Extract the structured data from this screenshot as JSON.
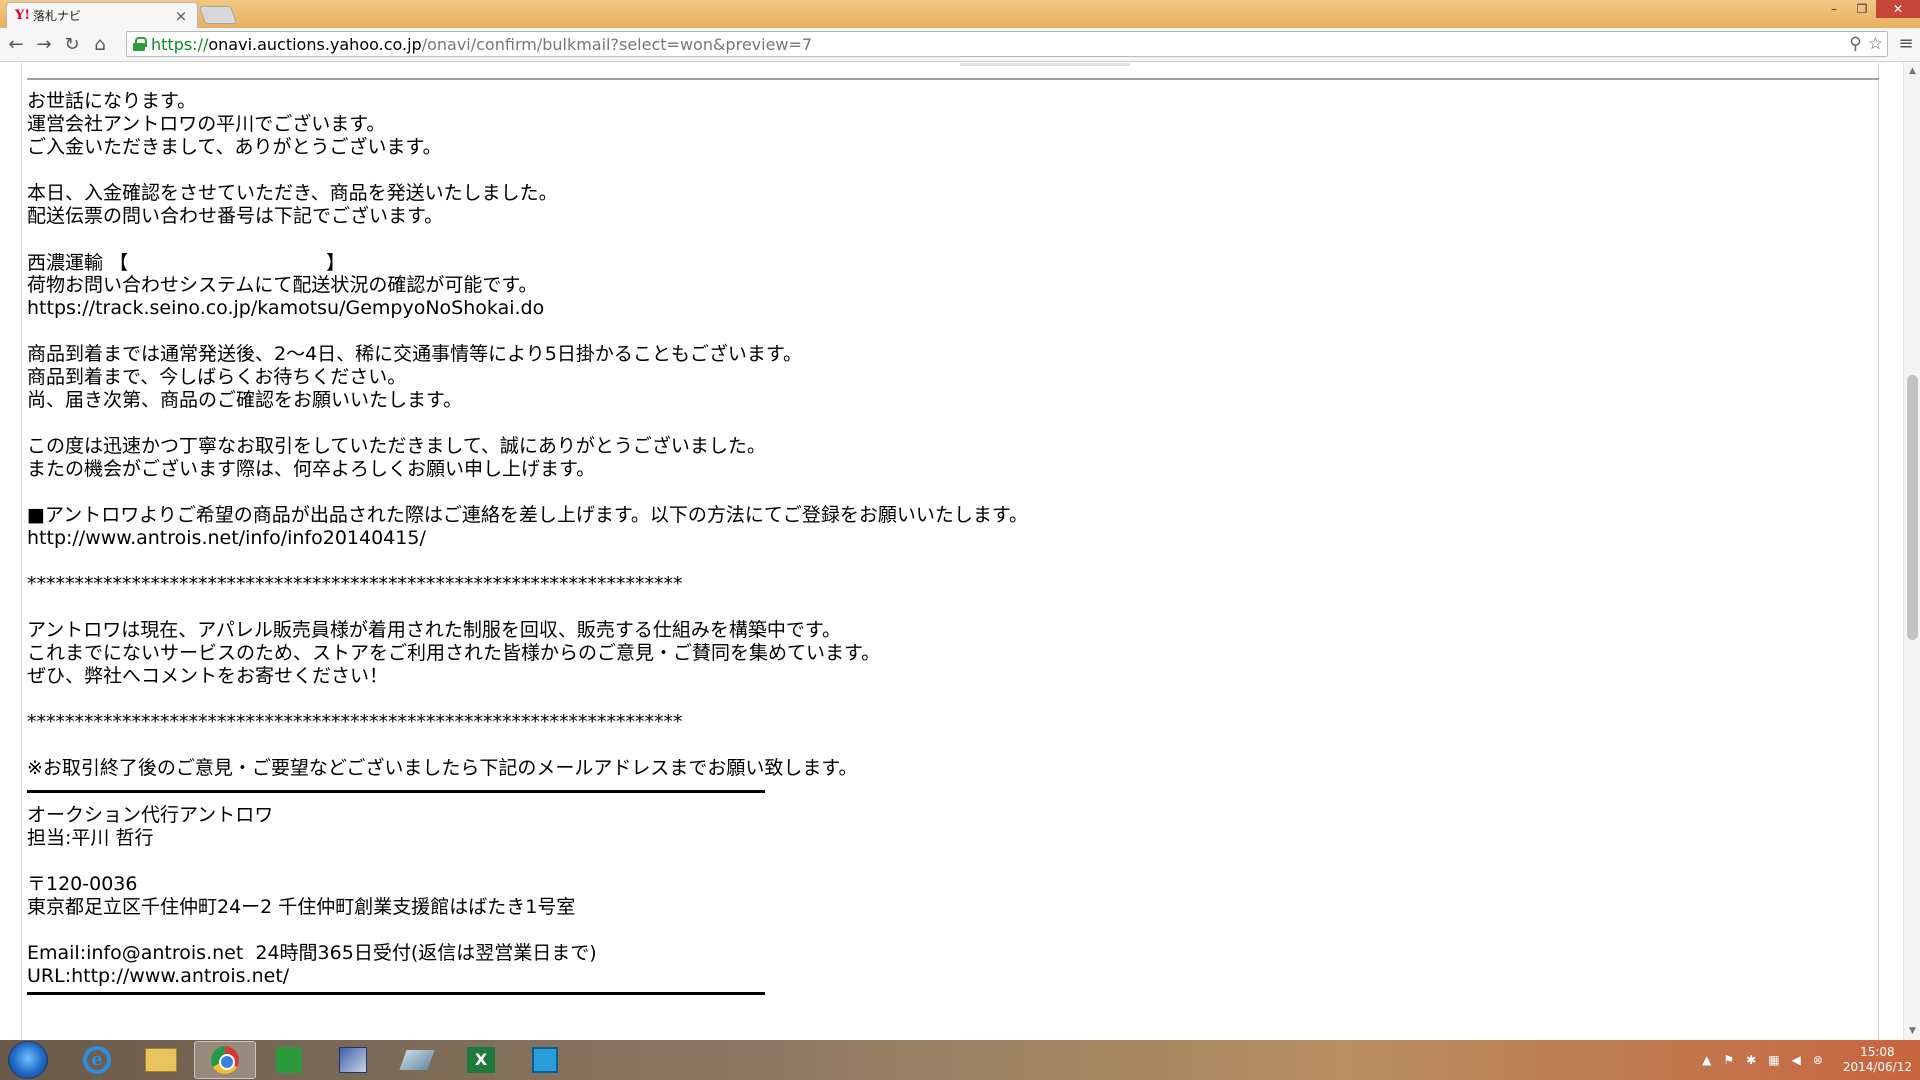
{
  "browser": {
    "tab_title": "落札ナビ",
    "tab_favicon": "Y!",
    "url_scheme": "https://",
    "url_host": "onavi.auctions.yahoo.co.jp",
    "url_path": "/onavi/confirm/bulkmail?select=won&preview=7",
    "window_minimize": "–",
    "window_restore": "❐",
    "window_close": "✕"
  },
  "mail": {
    "greeting_1": "お世話になります。",
    "greeting_2": "運営会社アントロワの平川でございます。",
    "greeting_3": "ご入金いただきまして、ありがとうございます。",
    "shipped_1": "本日、入金確認をさせていただき、商品を発送いたしました。",
    "shipped_2": "配送伝票の問い合わせ番号は下記でございます。",
    "carrier_name": "西濃運輸",
    "bracket_open": "【",
    "bracket_close": "】",
    "tracking_note": "荷物お問い合わせシステムにて配送状況の確認が可能です。",
    "tracking_url": "https://track.seino.co.jp/kamotsu/GempyoNoShokai.do",
    "arrival_1": "商品到着までは通常発送後、2～4日、稀に交通事情等により5日掛かることもございます。",
    "arrival_2": "商品到着まで、今しばらくお待ちください。",
    "arrival_3": "尚、届き次第、商品のご確認をお願いいたします。",
    "thanks_1": "この度は迅速かつ丁寧なお取引をしていただきまして、誠にありがとうございました。",
    "thanks_2": "またの機会がございます際は、何卒よろしくお願い申し上げます。",
    "notice_1": "■アントロワよりご希望の商品が出品された際はご連絡を差し上げます。以下の方法にてご登録をお願いいたします。",
    "notice_url": "http://www.antrois.net/info/info20140415/",
    "stars": "*********************************************************************",
    "service_1": "アントロワは現在、アパレル販売員様が着用された制服を回収、販売する仕組みを構築中です。",
    "service_2": "これまでにないサービスのため、ストアをご利用された皆様からのご意見・ご賛同を集めています。",
    "service_3": "ぜひ、弊社へコメントをお寄せください！",
    "feedback": "※お取引終了後のご意見・ご要望などございましたら下記のメールアドレスまでお願い致します。",
    "sig_company": "オークション代行アントロワ",
    "sig_person": "担当:平川 哲行",
    "sig_postal": "〒120-0036",
    "sig_address": "東京都足立区千住仲町24ー2 千住仲町創業支援館はばたき1号室",
    "sig_email": "Email:info@antrois.net  24時間365日受付(返信は翌営業日まで)",
    "sig_url": "URL:http://www.antrois.net/"
  },
  "taskbar": {
    "clock_time": "15:08",
    "clock_date": "2014/06/12"
  }
}
